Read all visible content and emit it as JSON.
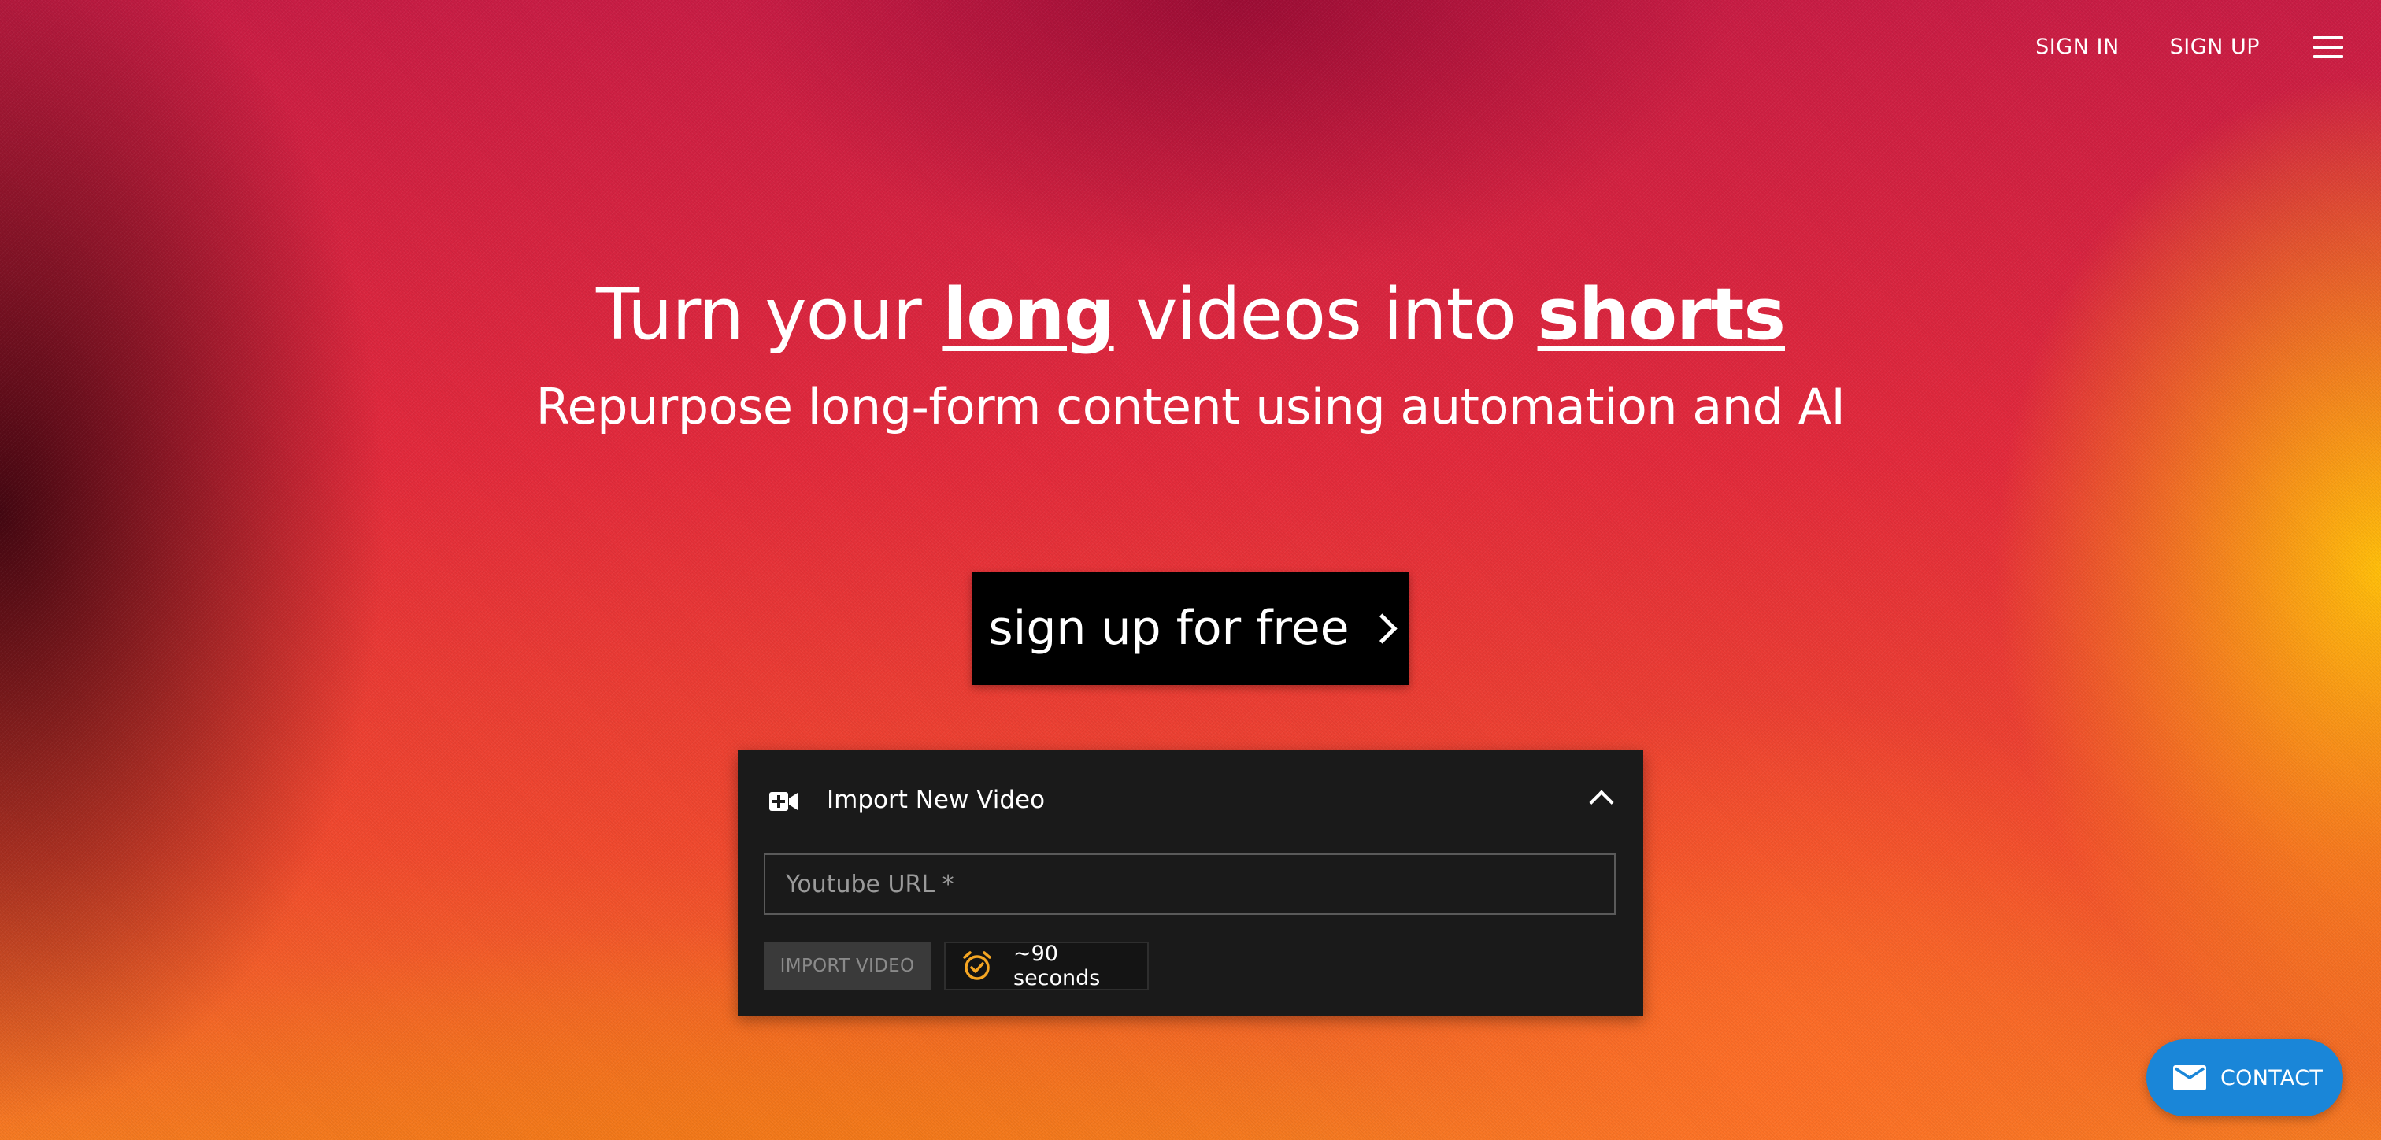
{
  "nav": {
    "sign_in": "SIGN IN",
    "sign_up": "SIGN UP"
  },
  "hero": {
    "title_part1": "Turn your ",
    "title_emph1": "long",
    "title_part2": " videos into ",
    "title_emph2": "shorts",
    "subtitle": "Repurpose long-form content using automation and AI"
  },
  "cta": {
    "label": "sign up for free"
  },
  "import_panel": {
    "title": "Import New Video",
    "url_placeholder": "Youtube URL *",
    "url_value": "",
    "import_button": "IMPORT VIDEO",
    "time_estimate": "~90 seconds",
    "icons": {
      "header": "video-plus-icon",
      "collapse": "chevron-up-icon",
      "timer": "alarm-check-icon"
    }
  },
  "contact": {
    "label": "CONTACT",
    "icon": "mail-icon"
  },
  "colors": {
    "panel_bg": "#1a1a1a",
    "cta_bg": "#000000",
    "contact_bg": "#1a86d8",
    "timer_accent": "#f5a623"
  }
}
